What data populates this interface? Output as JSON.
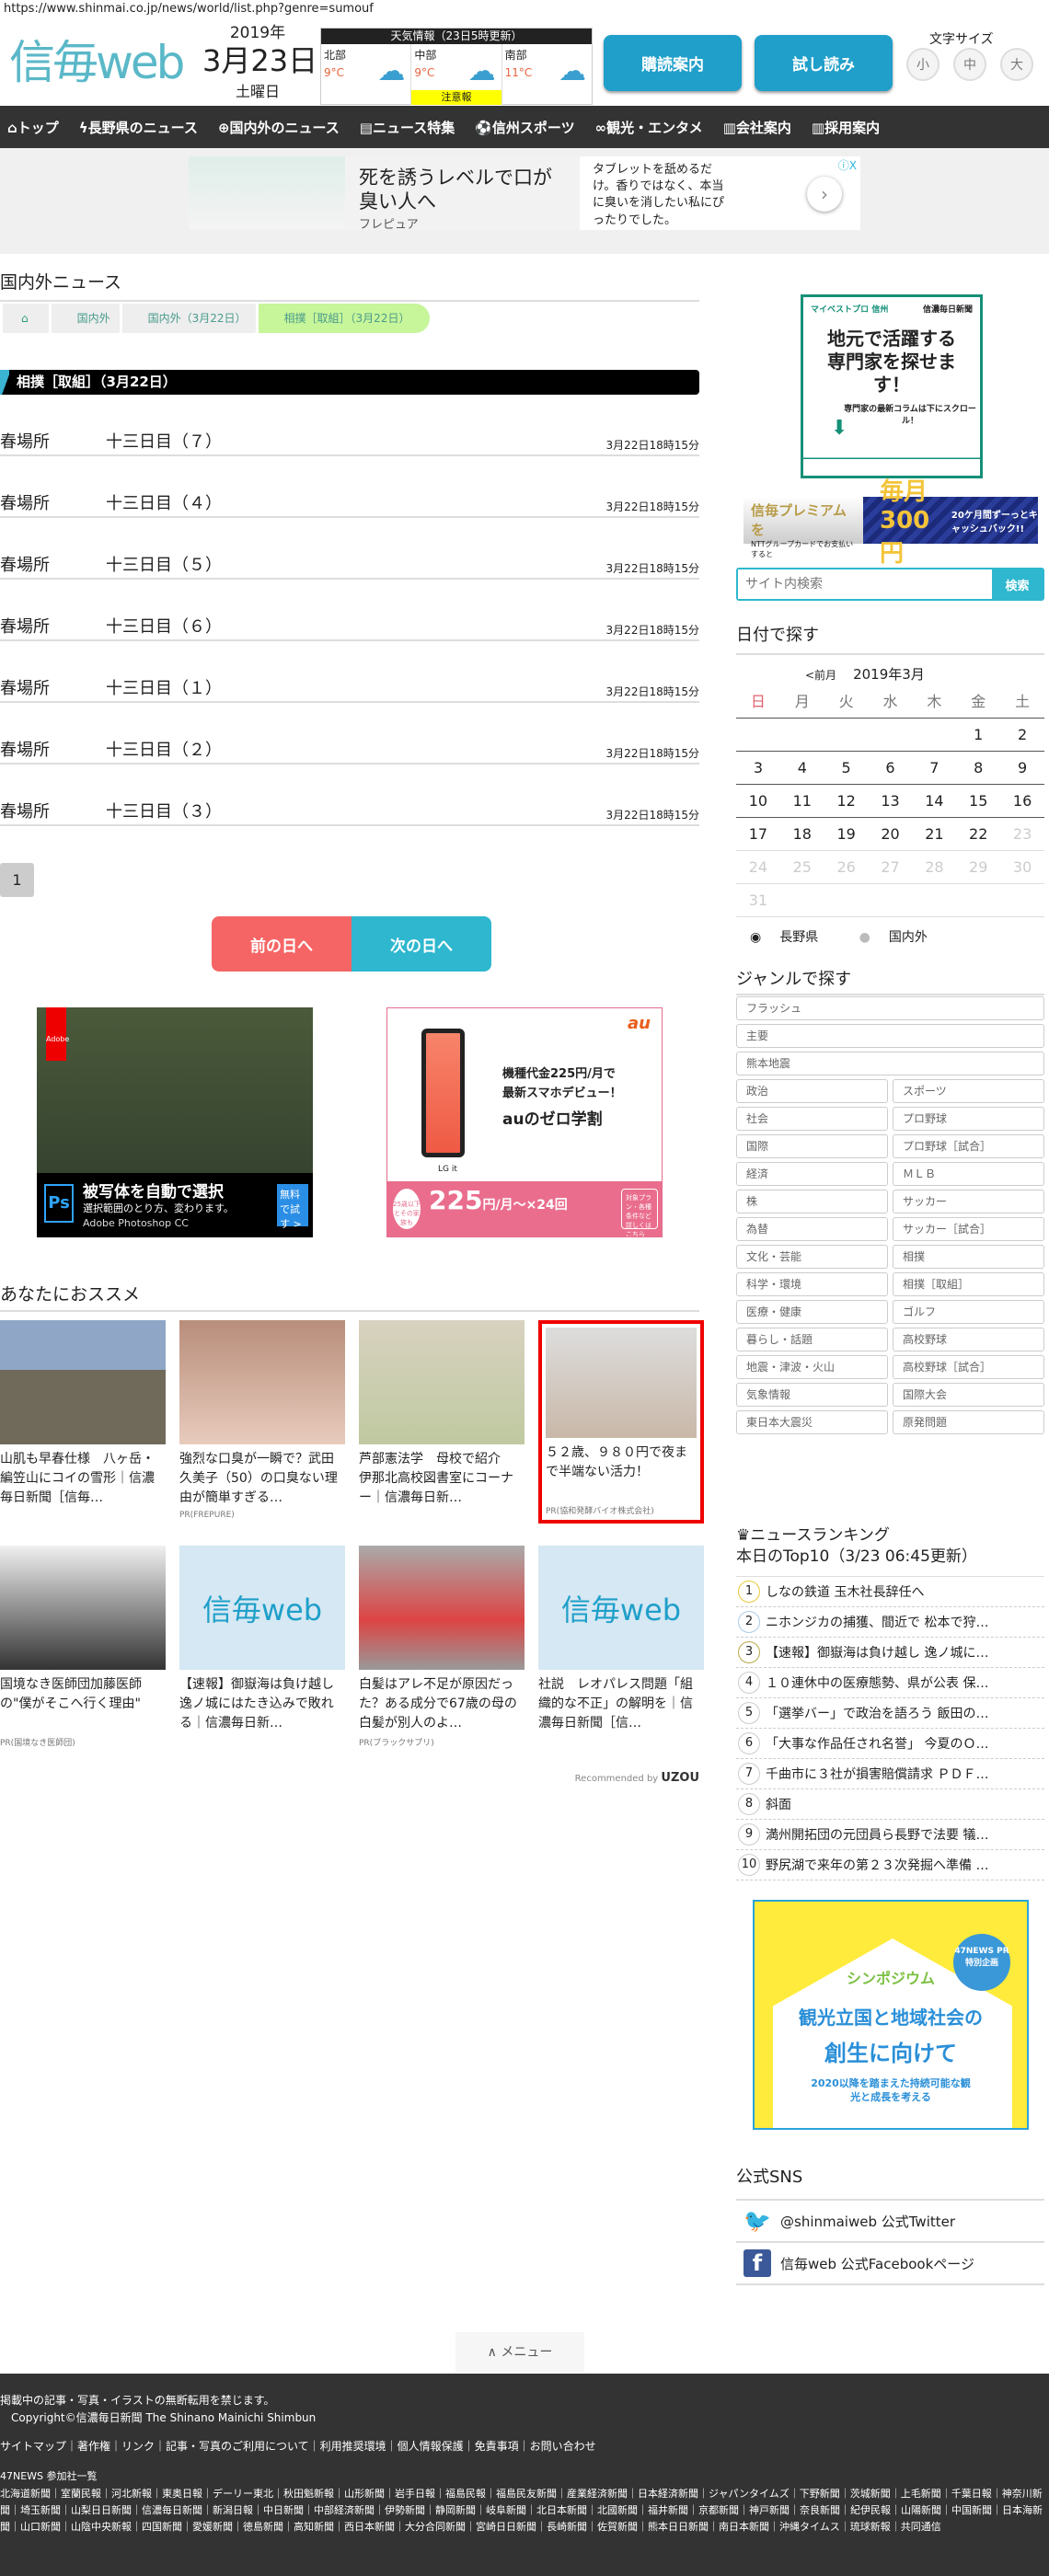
{
  "browser": {
    "url": "https://www.shinmai.co.jp/news/world/list.php?genre=sumouf"
  },
  "header": {
    "logo": "信毎web",
    "year": "2019年",
    "date": "3月23日",
    "weekday": "土曜日",
    "weather": {
      "title": "天気情報（23日5時更新）",
      "regions": [
        {
          "name": "北部",
          "temp": "9°C"
        },
        {
          "name": "中部",
          "temp": "9°C",
          "warning": "注意報"
        },
        {
          "name": "南部",
          "temp": "11°C"
        }
      ]
    },
    "subscribe": "購読案内",
    "trial": "試し読み",
    "font_size_label": "文字サイズ",
    "font_sizes": [
      "小",
      "中",
      "大"
    ]
  },
  "nav": [
    "トップ",
    "長野県のニュース",
    "国内外のニュース",
    "ニュース特集",
    "信州スポーツ",
    "観光・エンタメ",
    "会社案内",
    "採用案内"
  ],
  "top_ad": {
    "headline": "死を誘うレベルで口が臭い人へ",
    "brand": "フレピュア",
    "body": "タブレットを舐めるだけ。香りではなく、本当に臭いを消したい私にぴったりでした。"
  },
  "main": {
    "section_title": "国内外ニュース",
    "breadcrumb": [
      "国内外",
      "国内外（3月22日）",
      "相撲［取組］（3月22日）"
    ],
    "list_title": "相撲［取組］（3月22日）",
    "items": [
      {
        "a": "春場所",
        "b": "十三日目（７）",
        "time": "3月22日18時15分"
      },
      {
        "a": "春場所",
        "b": "十三日目（４）",
        "time": "3月22日18時15分"
      },
      {
        "a": "春場所",
        "b": "十三日目（５）",
        "time": "3月22日18時15分"
      },
      {
        "a": "春場所",
        "b": "十三日目（６）",
        "time": "3月22日18時15分"
      },
      {
        "a": "春場所",
        "b": "十三日目（１）",
        "time": "3月22日18時15分"
      },
      {
        "a": "春場所",
        "b": "十三日目（２）",
        "time": "3月22日18時15分"
      },
      {
        "a": "春場所",
        "b": "十三日目（３）",
        "time": "3月22日18時15分"
      }
    ],
    "page": "1",
    "prev": "前の日へ",
    "next": "次の日へ"
  },
  "ads": {
    "adobe": {
      "badge": "Adobe",
      "ps": "Ps",
      "headline": "被写体を自動で選択",
      "sub": "選択範囲のとり方、変わります。",
      "product": "Adobe Photoshop CC",
      "cta": "無料で試す >"
    },
    "au": {
      "logo": "au",
      "model": "LG it",
      "line1": "機種代金225円/月で",
      "line2": "最新スマホデビュー！",
      "line3": "auのゼロ学割",
      "price": "225",
      "price_unit": "円/月〜×24回",
      "circle": "25歳以下とその家族も",
      "details": "対象プラン・各種条件など詳しくはこちら"
    }
  },
  "recommend": {
    "title": "あなたにおススメ",
    "cards": [
      {
        "title": "山肌も早春仕様　八ヶ岳・編笠山にコイの雪形｜信濃毎日新聞［信毎…",
        "pr": ""
      },
      {
        "title": "強烈な口臭が一瞬で？武田久美子（50）の口臭ない理由が簡単すぎる…",
        "pr": "PR(FREPURE)"
      },
      {
        "title": "芦部憲法学　母校で紹介　伊那北高校図書室にコーナー｜信濃毎日新…",
        "pr": ""
      },
      {
        "title": "５２歳、９８０円で夜まで半端ない活力！",
        "pr": "PR(協和発酵バイオ株式会社)"
      },
      {
        "title": "国境なき医師団加藤医師の\"僕がそこへ行く理由\"",
        "pr": "PR(国境なき医師団)"
      },
      {
        "title": "【速報】御嶽海は負け越し　逸ノ城にはたき込みで敗れる｜信濃毎日新…",
        "pr": "",
        "logo": "信毎web"
      },
      {
        "title": "白髪はアレ不足が原因だった？ある成分で67歳の母の白髪が別人のよ…",
        "pr": "PR(ブラックサプリ)"
      },
      {
        "title": "社説　レオパレス問題「組織的な不正」の解明を｜信濃毎日新聞［信…",
        "pr": "",
        "logo": "信毎web"
      }
    ],
    "recommended_by": "Recommended by",
    "uzou": "UZOU"
  },
  "sidebar": {
    "ad1": {
      "brand": "マイベストプロ 信州",
      "paper": "信濃毎日新聞",
      "headline": "地元で活躍する専門家を探せます！",
      "sub": "専門家の最新コラムは下にスクロール！"
    },
    "ad2": {
      "l1": "信毎プレミアムを",
      "l2": "NTTグループカードでお支払いすると",
      "amount": "毎月300円",
      "r2": "20ケ月間ずーっとキャッシュバック!!"
    },
    "search": {
      "placeholder": "サイト内検索",
      "button": "検索"
    },
    "date_title": "日付で探す",
    "calendar": {
      "prev": "<前月",
      "month": "2019年3月",
      "weekdays": [
        "日",
        "月",
        "火",
        "水",
        "木",
        "金",
        "土"
      ],
      "weeks": [
        [
          "",
          "",
          "",
          "",
          "",
          "1",
          "2"
        ],
        [
          "3",
          "4",
          "5",
          "6",
          "7",
          "8",
          "9"
        ],
        [
          "10",
          "11",
          "12",
          "13",
          "14",
          "15",
          "16"
        ],
        [
          "17",
          "18",
          "19",
          "20",
          "21",
          "22",
          "23"
        ],
        [
          "24",
          "25",
          "26",
          "27",
          "28",
          "29",
          "30"
        ],
        [
          "31",
          "",
          "",
          "",
          "",
          "",
          ""
        ]
      ],
      "last_active_day": 22
    },
    "radios": [
      "長野県",
      "国内外"
    ],
    "genre_title": "ジャンルで探す",
    "genres_full": [
      "フラッシュ",
      "主要",
      "熊本地震"
    ],
    "genres": [
      "政治",
      "スポーツ",
      "社会",
      "プロ野球",
      "国際",
      "プロ野球［試合］",
      "経済",
      "ＭＬＢ",
      "株",
      "サッカー",
      "為替",
      "サッカー［試合］",
      "文化・芸能",
      "相撲",
      "科学・環境",
      "相撲［取組］",
      "医療・健康",
      "ゴルフ",
      "暮らし・話題",
      "高校野球",
      "地震・津波・火山",
      "高校野球［試合］",
      "気象情報",
      "国際大会",
      "東日本大震災",
      "原発問題"
    ],
    "ranking_title": "ニュースランキング",
    "ranking_sub": "本日のTop10（3/23 06:45更新）",
    "ranking": [
      "しなの鉄道 玉木社長辞任へ",
      "ニホンジカの捕獲、間近で 松本で狩…",
      "【速報】御嶽海は負け越し 逸ノ城に…",
      "１０連休中の医療態勢、県が公表 保…",
      "「選挙バー」で政治を語ろう 飯田の…",
      "「大事な作品任され名誉」 今夏のＯ…",
      "千曲市に３社が損害賠償請求 ＰＤＦ…",
      "斜面",
      "満州開拓団の元団員ら長野で法要 犠…",
      "野尻湖で来年の第２３次発掘へ準備 …"
    ],
    "ad3": {
      "label": "シンポジウム",
      "h1": "観光立国と地域社会の",
      "h2": "創生に向けて",
      "sub": "2020以降を踏まえた持続可能な観光と成長を考える",
      "badge": "47NEWS PR 特別企画"
    },
    "sns_title": "公式SNS",
    "twitter": "@shinmaiweb 公式Twitter",
    "facebook": "信毎web 公式Facebookページ"
  },
  "menu": "メニュー",
  "footer": {
    "notice": "掲載中の記事・写真・イラストの無断転用を禁じます。",
    "copyright": "Copyright©信濃毎日新聞 The Shinano Mainichi Shimbun",
    "links": "サイトマップ｜著作権｜リンク｜記事・写真のご利用について｜利用推奨環境｜個人情報保護｜免責事項｜お問い合わせ",
    "n47_title": "47NEWS 参加社一覧",
    "n47": "北海道新聞｜室蘭民報｜河北新報｜東奥日報｜デーリー東北｜秋田魁新報｜山形新聞｜岩手日報｜福島民報｜福島民友新聞｜産業経済新聞｜日本経済新聞｜ジャパンタイムズ｜下野新聞｜茨城新聞｜上毛新聞｜千葉日報｜神奈川新聞｜埼玉新聞｜山梨日日新聞｜信濃毎日新聞｜新潟日報｜中日新聞｜中部経済新聞｜伊勢新聞｜静岡新聞｜岐阜新聞｜北日本新聞｜北國新聞｜福井新聞｜京都新聞｜神戸新聞｜奈良新聞｜紀伊民報｜山陽新聞｜中国新聞｜日本海新聞｜山口新聞｜山陰中央新報｜四国新聞｜愛媛新聞｜徳島新聞｜高知新聞｜西日本新聞｜大分合同新聞｜宮崎日日新聞｜長崎新聞｜佐賀新聞｜熊本日日新聞｜南日本新聞｜沖縄タイムス｜琉球新報｜共同通信"
  },
  "colors": {
    "brand": "#1f9fc9",
    "prev": "#f66565",
    "next": "#2eb7cf",
    "nav": "#333333"
  }
}
